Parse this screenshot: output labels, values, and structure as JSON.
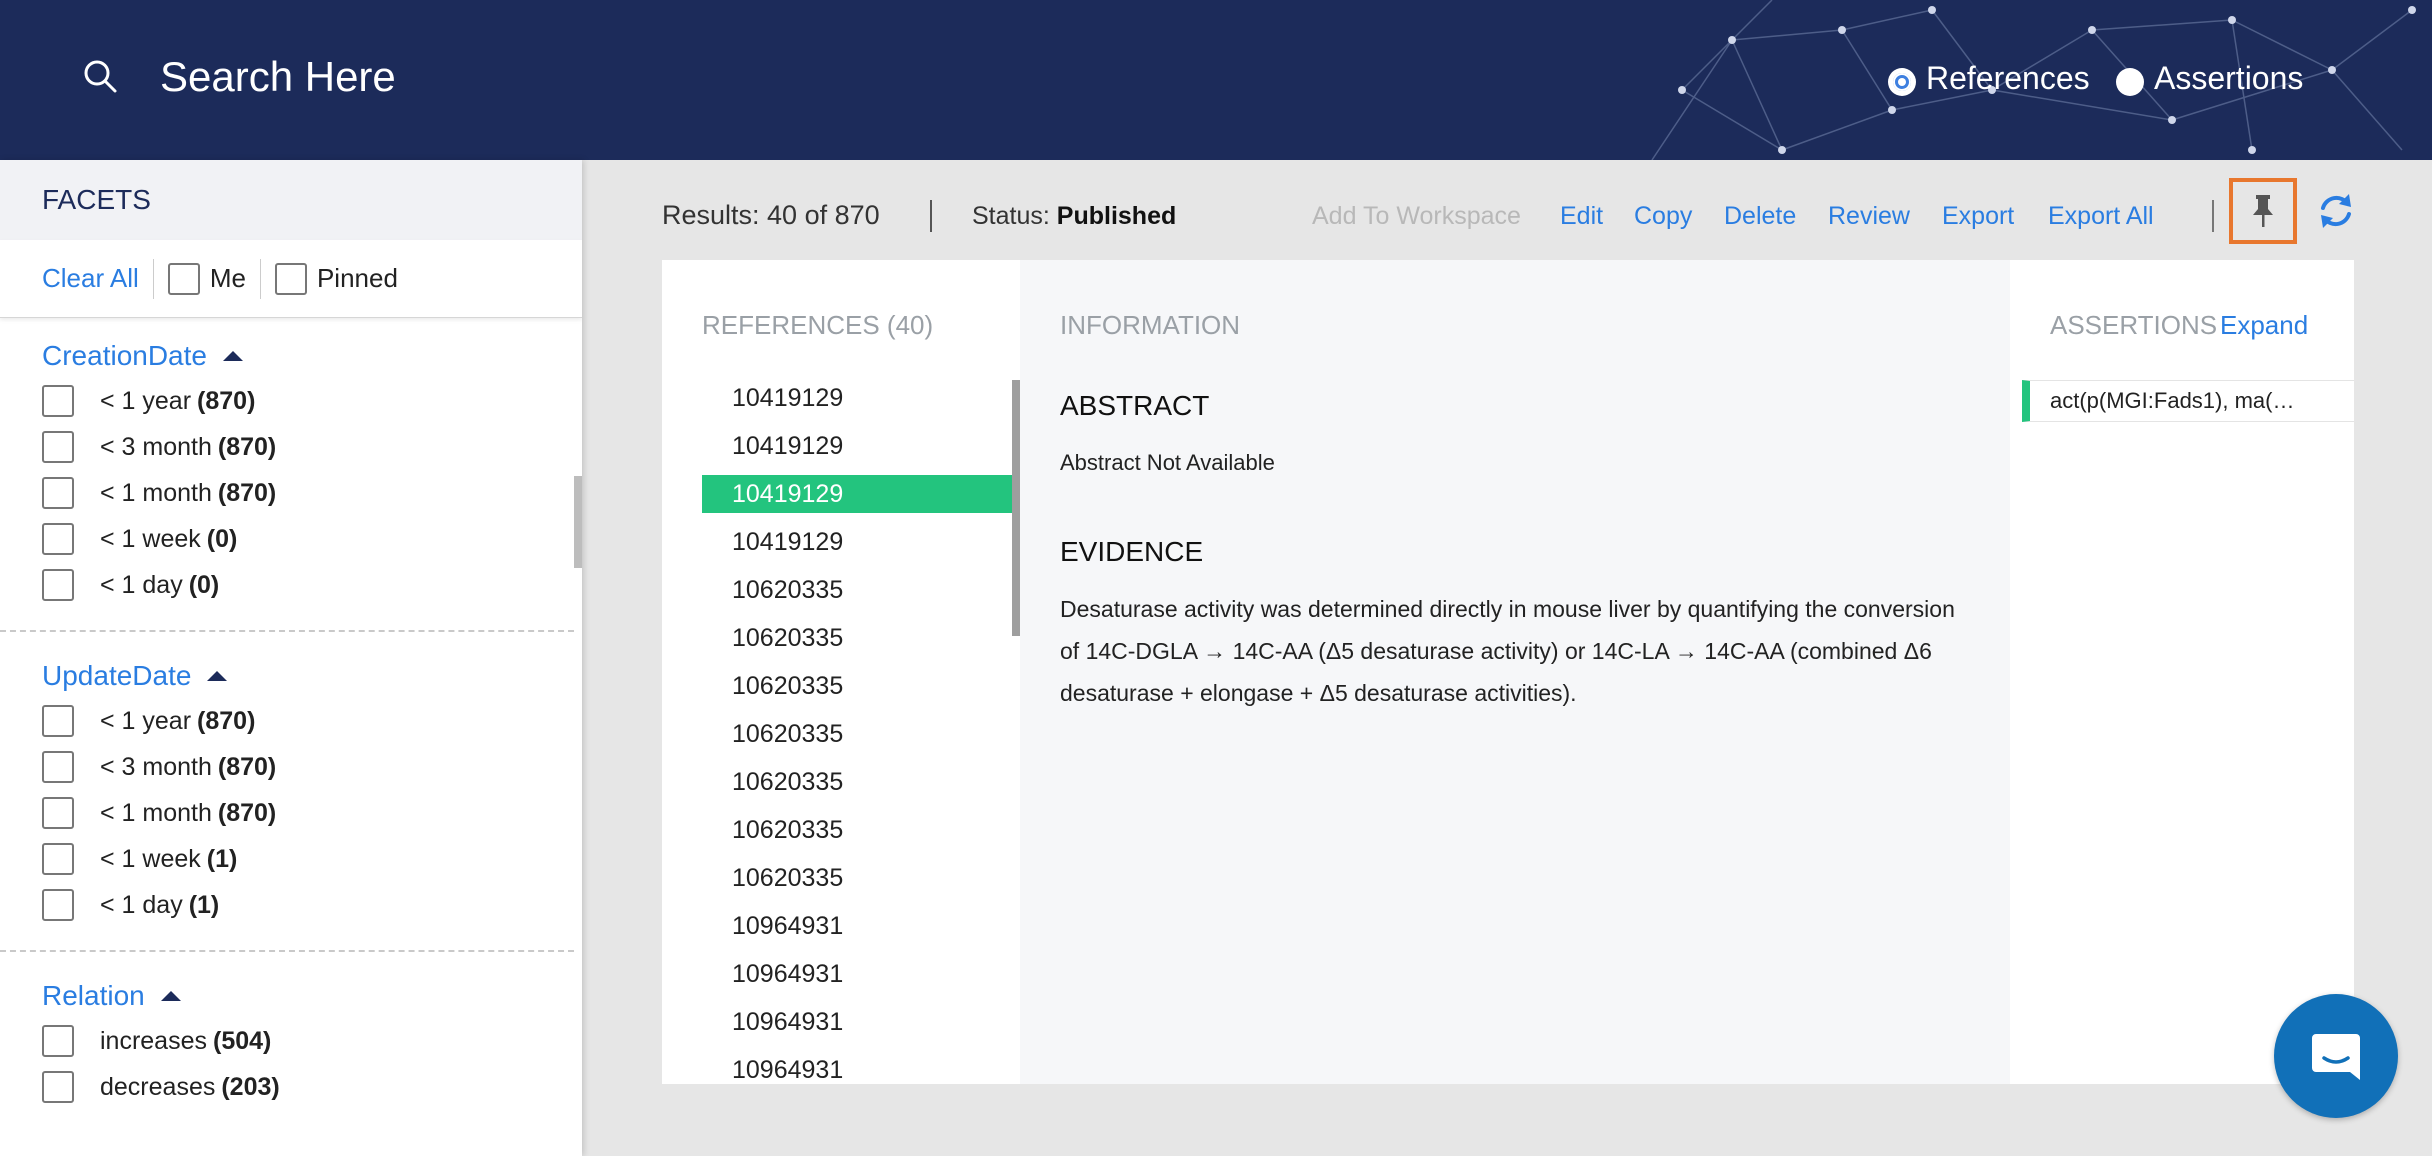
{
  "header": {
    "search_placeholder": "Search Here",
    "modes": [
      {
        "label": "References",
        "selected": true
      },
      {
        "label": "Assertions",
        "selected": false
      }
    ],
    "background_color": "#1c2b5a"
  },
  "sidebar": {
    "title": "FACETS",
    "clear_all": "Clear All",
    "filters": {
      "me": "Me",
      "pinned": "Pinned"
    },
    "groups": [
      {
        "title": "CreationDate",
        "items": [
          {
            "label": "< 1 year",
            "count": "(870)"
          },
          {
            "label": "< 3 month",
            "count": "(870)"
          },
          {
            "label": "< 1 month",
            "count": "(870)"
          },
          {
            "label": "< 1 week",
            "count": "(0)"
          },
          {
            "label": "< 1 day",
            "count": "(0)"
          }
        ]
      },
      {
        "title": "UpdateDate",
        "items": [
          {
            "label": "< 1 year",
            "count": "(870)"
          },
          {
            "label": "< 3 month",
            "count": "(870)"
          },
          {
            "label": "< 1 month",
            "count": "(870)"
          },
          {
            "label": "< 1 week",
            "count": "(1)"
          },
          {
            "label": "< 1 day",
            "count": "(1)"
          }
        ]
      },
      {
        "title": "Relation",
        "items": [
          {
            "label": "increases",
            "count": "(504)"
          },
          {
            "label": "decreases",
            "count": "(203)"
          }
        ]
      }
    ]
  },
  "toolbar": {
    "results": "Results: 40 of 870",
    "status_label": "Status:",
    "status_value": "Published",
    "actions": {
      "add_to_workspace": "Add To Workspace",
      "edit": "Edit",
      "copy": "Copy",
      "delete": "Delete",
      "review": "Review",
      "export": "Export",
      "export_all": "Export All"
    },
    "accent_color": "#2a7de1",
    "highlight_color": "#e8772e"
  },
  "references": {
    "header": "REFERENCES (40)",
    "selected_index": 2,
    "items": [
      "10419129",
      "10419129",
      "10419129",
      "10419129",
      "10620335",
      "10620335",
      "10620335",
      "10620335",
      "10620335",
      "10620335",
      "10620335",
      "10964931",
      "10964931",
      "10964931",
      "10964931"
    ],
    "selected_color": "#23c47e"
  },
  "information": {
    "header": "INFORMATION",
    "abstract_title": "ABSTRACT",
    "abstract_text": "Abstract Not Available",
    "evidence_title": "EVIDENCE",
    "evidence_text": "Desaturase activity was determined directly in mouse liver by quantifying the conversion of 14C-DGLA → 14C-AA (Δ5 desaturase activity) or 14C-LA → 14C-AA (combined Δ6 desaturase + elongase + Δ5 desaturase activities)."
  },
  "assertions": {
    "header": "ASSERTIONS",
    "expand": "Expand",
    "items": [
      "act(p(MGI:Fads1), ma(…"
    ]
  },
  "chat": {
    "icon": "chat-bubble-icon",
    "color": "#1170b8"
  }
}
